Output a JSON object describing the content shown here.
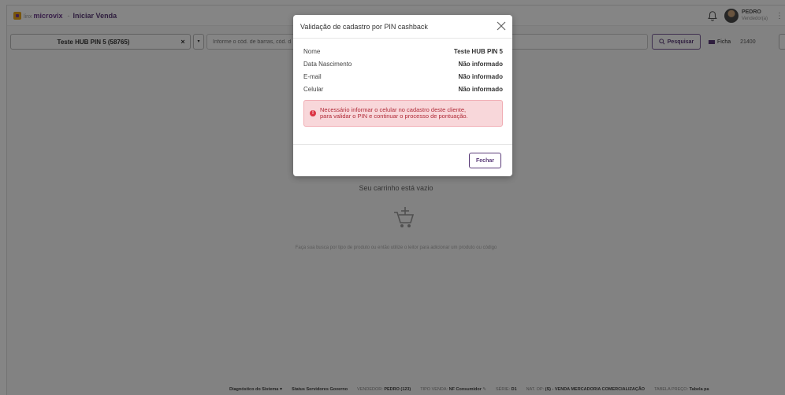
{
  "header": {
    "logo_small": "linx",
    "logo_brand": "microvix",
    "separator": "-",
    "page_title": "Iniciar Venda",
    "user_name": "PEDRO",
    "user_role": "Vendedor(a)",
    "more": "⋮"
  },
  "toolbar": {
    "client_name": "Teste HUB PIN 5 (58765)",
    "clear_icon": "×",
    "dropdown_icon": "▾",
    "search_placeholder": "Informe o cód. de barras, cód. d",
    "search_button": "Pesquisar",
    "ficha_label": "Ficha",
    "ficha_number": "21400"
  },
  "cart": {
    "empty_title": "Seu carrinho está vazio",
    "hint": "Faça sua busca por tipo de produto ou então utilize o leitor para adicionar um produto ou código"
  },
  "statusbar": {
    "diag": "Diagnóstico do Sistema",
    "servers": "Status Servidores Governo",
    "seller_label": "VENDEDOR:",
    "seller_value": "PEDRO (123)",
    "sale_type_label": "TIPO VENDA:",
    "sale_type_value": "NF Consumidor",
    "serie_label": "SÉRIE:",
    "serie_value": "D1",
    "natop_label": "NAT. OP:",
    "natop_value": "(S) - VENDA MERCADORIA COMERCIALIZAÇÃO",
    "price_label": "TABELA PREÇO:",
    "price_value": "Tabela pa"
  },
  "modal": {
    "title": "Validação de cadastro por PIN cashback",
    "fields": [
      {
        "label": "Nome",
        "value": "Teste HUB PIN 5"
      },
      {
        "label": "Data Nascimento",
        "value": "Não informado"
      },
      {
        "label": "E-mail",
        "value": "Não informado"
      },
      {
        "label": "Celular",
        "value": "Não informado"
      }
    ],
    "alert_icon": "!",
    "alert_line1": "Necessário informar o celular no cadastro deste cliente,",
    "alert_line2": "para validar o PIN e continuar o processo de pontuação.",
    "close_button": "Fechar"
  },
  "colors": {
    "brand": "#5a3b78",
    "alert_bg": "#f8d7da",
    "alert_text": "#b02a37",
    "alert_icon": "#dc3545"
  },
  "icons": [
    "bell-icon",
    "search-icon",
    "ficha-icon",
    "cart-add-icon",
    "close-icon",
    "alert-icon",
    "heart-shield-icon",
    "pencil-icon"
  ]
}
